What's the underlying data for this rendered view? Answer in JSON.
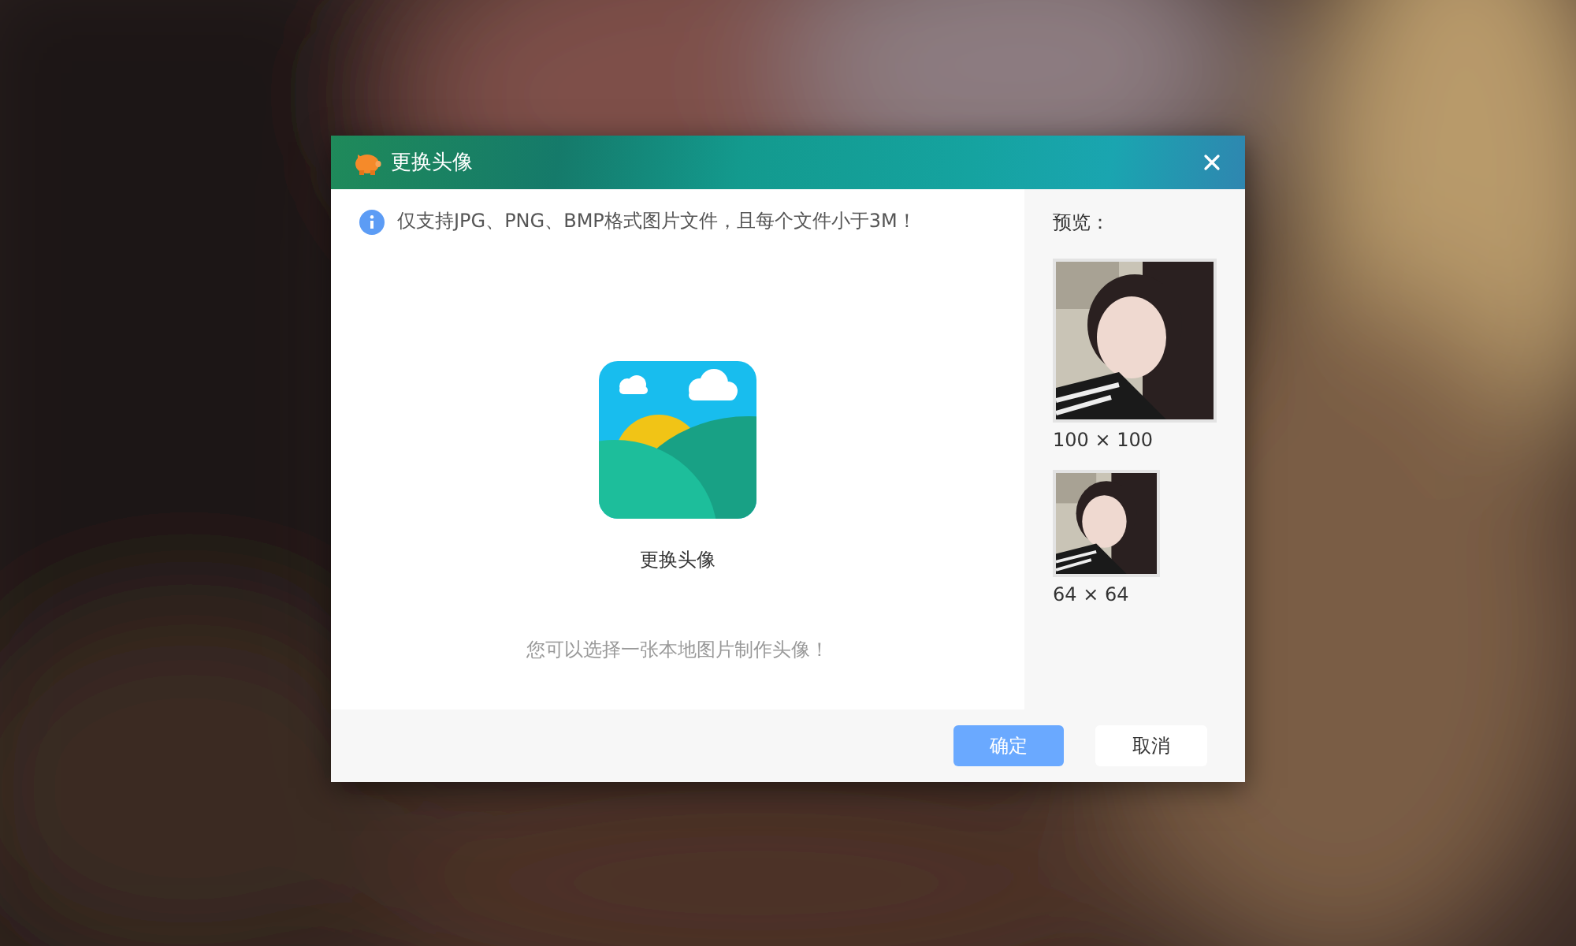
{
  "dialog": {
    "title": "更换头像",
    "notice": "仅支持JPG、PNG、BMP格式图片文件，且每个文件小于3M！",
    "upload": {
      "label": "更换头像",
      "hint": "您可以选择一张本地图片制作头像！"
    },
    "preview": {
      "title": "预览：",
      "sizes": [
        {
          "label": "100 × 100",
          "kind": "large"
        },
        {
          "label": "64 × 64",
          "kind": "small"
        }
      ]
    },
    "buttons": [
      {
        "label": "确定",
        "kind": "primary"
      },
      {
        "label": "取消",
        "kind": "secondary"
      }
    ]
  }
}
